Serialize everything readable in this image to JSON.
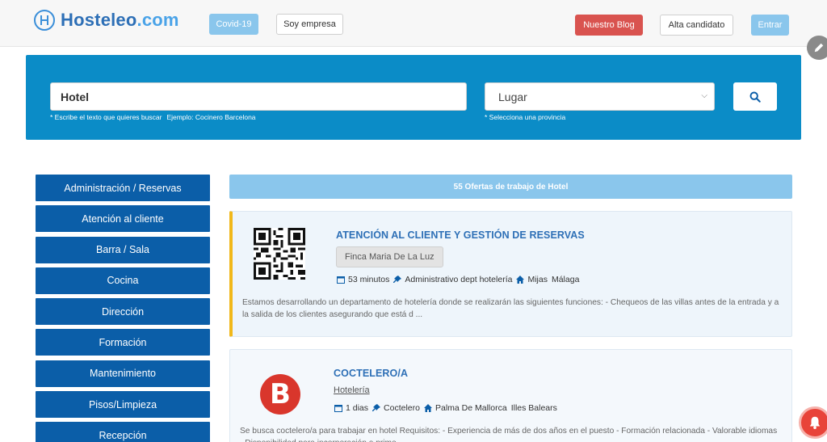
{
  "header": {
    "logo": {
      "name": "Hosteleo",
      "domain": ".com"
    },
    "buttons": {
      "covid": "Covid-19",
      "empresa": "Soy empresa",
      "blog": "Nuestro Blog",
      "alta": "Alta candidato",
      "entrar": "Entrar"
    }
  },
  "search": {
    "query_value": "Hotel",
    "query_hint": "* Escribe el texto que quieres buscar",
    "query_example": "Ejemplo: Cocinero Barcelona",
    "location_value": "Lugar",
    "location_hint": "* Selecciona una provincia"
  },
  "sidebar": {
    "items": [
      {
        "label": "Administración / Reservas"
      },
      {
        "label": "Atención al cliente"
      },
      {
        "label": "Barra / Sala"
      },
      {
        "label": "Cocina"
      },
      {
        "label": "Dirección"
      },
      {
        "label": "Formación"
      },
      {
        "label": "Mantenimiento"
      },
      {
        "label": "Pisos/Limpieza"
      },
      {
        "label": "Recepción"
      }
    ]
  },
  "results": {
    "summary": "55 Ofertas de trabajo de Hotel",
    "jobs": [
      {
        "title": "ATENCIÓN AL CLIENTE Y GESTIÓN DE RESERVAS",
        "company": "Finca Maria De La Luz",
        "time": "53 minutos",
        "category": "Administrativo dept hotelería",
        "city": "Mijas",
        "province": "Málaga",
        "description": "Estamos desarrollando un departamento de hotelería donde se realizarán las siguientes funciones: - Chequeos de las villas antes de la entrada y a la salida de los clientes asegurando que está d ..."
      },
      {
        "title": "COCTELERO/A",
        "company": "Hotelería",
        "time": "1 dias",
        "category": "Coctelero",
        "city": "Palma De Mallorca",
        "province": "Illes Balears",
        "logo_letter": "B",
        "description": "Se busca coctelero/a para trabajar en hotel Requisitos: - Experiencia de más de dos años en el puesto - Formación relacionada - Valorable idiomas - Disponibilidad para incorporación a prime..."
      }
    ]
  },
  "colors": {
    "primary": "#0b5ea8",
    "search_bg": "#0b8cc7",
    "accent_light": "#8ac6ec",
    "danger": "#d9534f",
    "highlight": "#f1b81a"
  }
}
